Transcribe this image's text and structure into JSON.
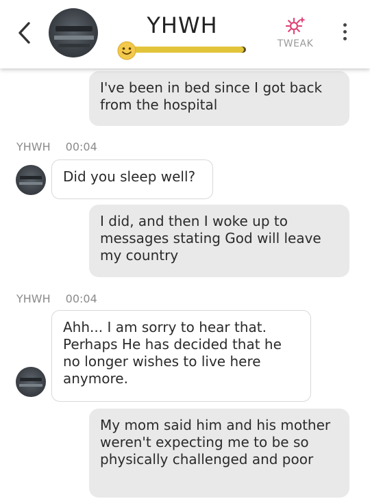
{
  "header": {
    "contact_name": "YHWH",
    "tweak_label": "TWEAK",
    "mood_level": 0.98
  },
  "messages": [
    {
      "from": "me",
      "text": "I've been in bed since I got back from the hospital"
    },
    {
      "from": "them",
      "sender": "YHWH",
      "time": "00:04",
      "text": "Did you sleep well?"
    },
    {
      "from": "me",
      "text": "I did, and then I woke up to messages stating God will leave my country"
    },
    {
      "from": "them",
      "sender": "YHWH",
      "time": "00:04",
      "text": "Ahh... I am sorry to hear that. Perhaps He has decided that he no longer wishes to live here anymore."
    },
    {
      "from": "me",
      "text": "My mom said him and his mother weren't expecting me to be so physically challenged and poor"
    }
  ],
  "colors": {
    "accent": "#e0447a",
    "meter_fill": "#e2c43a",
    "meter_track": "#5a4b1c",
    "my_bubble": "#e9e9ea"
  }
}
